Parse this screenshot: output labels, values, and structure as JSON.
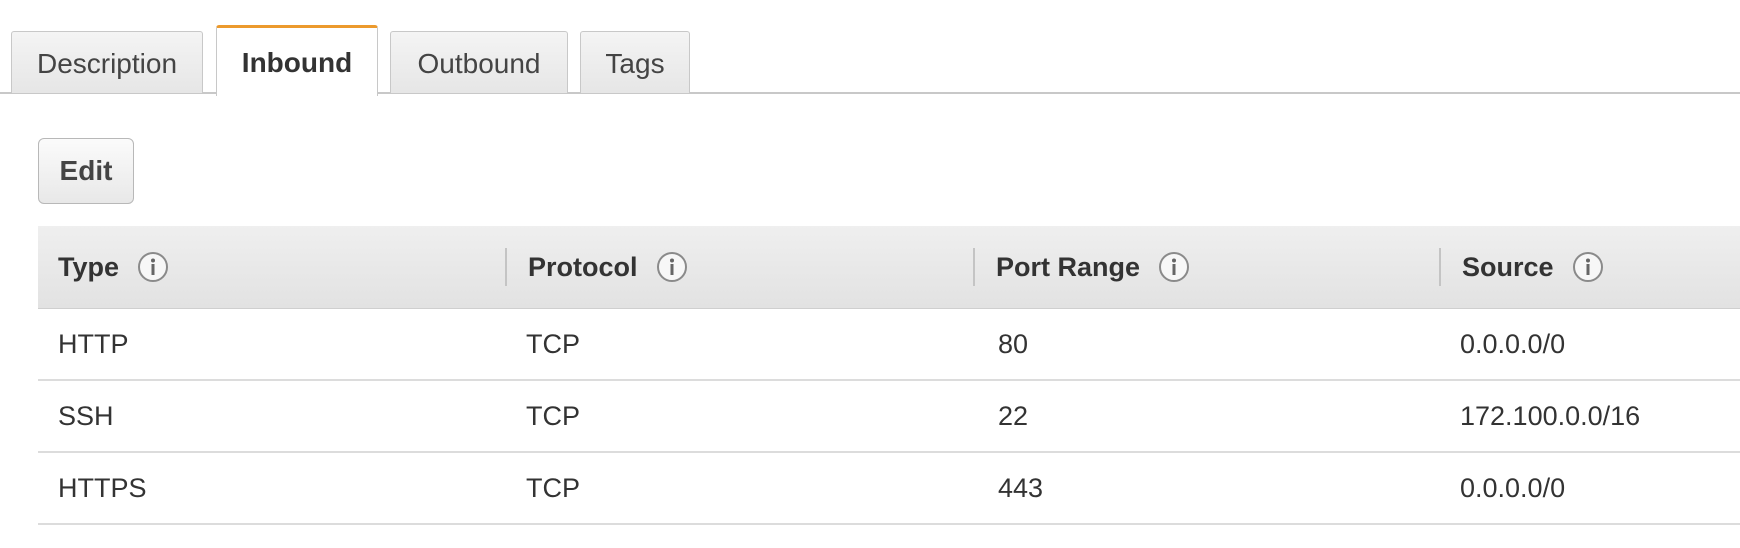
{
  "tabs": [
    {
      "label": "Description",
      "active": false
    },
    {
      "label": "Inbound",
      "active": true
    },
    {
      "label": "Outbound",
      "active": false
    },
    {
      "label": "Tags",
      "active": false
    }
  ],
  "toolbar": {
    "edit_label": "Edit"
  },
  "table": {
    "columns": [
      "Type",
      "Protocol",
      "Port Range",
      "Source"
    ],
    "rows": [
      [
        "HTTP",
        "TCP",
        "80",
        "0.0.0.0/0"
      ],
      [
        "SSH",
        "TCP",
        "22",
        "172.100.0.0/16"
      ],
      [
        "HTTPS",
        "TCP",
        "443",
        "0.0.0.0/0"
      ]
    ]
  },
  "colors": {
    "active_tab_accent": "#ec9a2d"
  },
  "icons": {
    "column_help": "info-icon"
  }
}
